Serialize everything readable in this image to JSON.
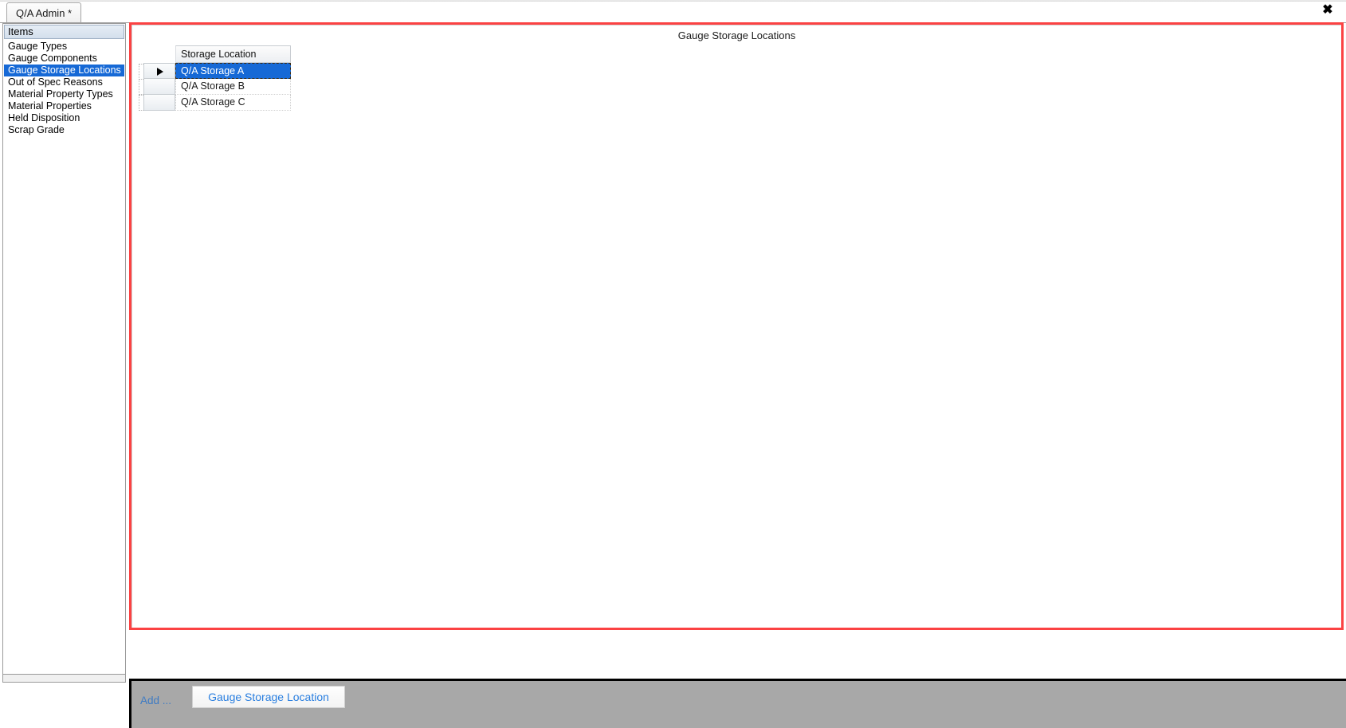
{
  "window": {
    "tab_label": "Q/A Admin *",
    "close_icon": "close-x-icon"
  },
  "sidebar": {
    "header": "Items",
    "items": [
      {
        "label": "Gauge Types",
        "selected": false
      },
      {
        "label": "Gauge Components",
        "selected": false
      },
      {
        "label": "Gauge Storage Locations",
        "selected": true
      },
      {
        "label": "Out of Spec Reasons",
        "selected": false
      },
      {
        "label": "Material Property Types",
        "selected": false
      },
      {
        "label": "Material Properties",
        "selected": false
      },
      {
        "label": "Held Disposition",
        "selected": false
      },
      {
        "label": "Scrap Grade",
        "selected": false
      }
    ]
  },
  "main": {
    "title": "Gauge Storage Locations",
    "grid": {
      "columns": [
        "Storage Location"
      ],
      "rows": [
        {
          "storage_location": "Q/A Storage A",
          "selected": true,
          "current": true
        },
        {
          "storage_location": "Q/A Storage B",
          "selected": false,
          "current": false
        },
        {
          "storage_location": "Q/A Storage C",
          "selected": false,
          "current": false
        }
      ],
      "current_row_indicator": "row-selector-arrow-icon"
    }
  },
  "bottom_bar": {
    "add_label": "Add ...",
    "add_button_label": "Gauge Storage Location"
  },
  "colors": {
    "panel_border_red": "#fb4243",
    "selection_blue": "#1669d6",
    "link_blue": "#2a7fe0",
    "bottom_bar_gray": "#a8a8a8"
  }
}
